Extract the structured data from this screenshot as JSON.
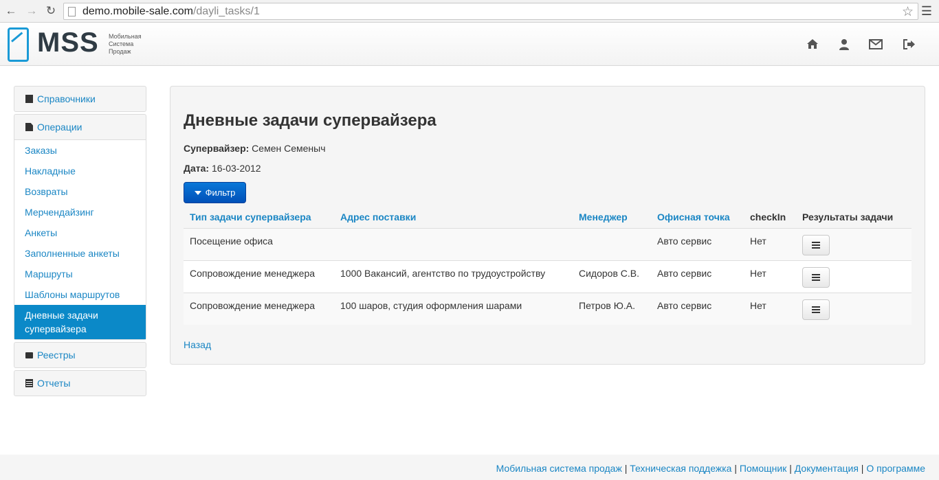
{
  "browser": {
    "url_host": "demo.mobile-sale.com",
    "url_path": "/dayli_tasks/1"
  },
  "header": {
    "logo_text": "MSS",
    "logo_sub_1": "Мобильная",
    "logo_sub_2": "Система",
    "logo_sub_3": "Продаж"
  },
  "sidebar": {
    "ref_label": "Справочники",
    "ops_label": "Операции",
    "ops_items": [
      {
        "label": "Заказы"
      },
      {
        "label": "Накладные"
      },
      {
        "label": "Возвраты"
      },
      {
        "label": "Мерчендайзинг"
      },
      {
        "label": "Анкеты"
      },
      {
        "label": "Заполненные анкеты"
      },
      {
        "label": "Маршруты"
      },
      {
        "label": "Шаблоны маршрутов"
      },
      {
        "label": "Дневные задачи супервайзера"
      }
    ],
    "registers_label": "Реестры",
    "reports_label": "Отчеты"
  },
  "main": {
    "title": "Дневные задачи супервайзера",
    "supervisor_label": "Супервайзер:",
    "supervisor_value": "Семен Семеныч",
    "date_label": "Дата:",
    "date_value": "16-03-2012",
    "filter_label": "Фильтр",
    "columns": {
      "type": "Тип задачи супервайзера",
      "address": "Адрес поставки",
      "manager": "Менеджер",
      "office": "Офисная точка",
      "checkin": "checkIn",
      "results": "Результаты задачи"
    },
    "rows": [
      {
        "type": "Посещение офиса",
        "address": "",
        "manager": "",
        "office": "Авто сервис",
        "checkin": "Нет"
      },
      {
        "type": "Сопровождение менеджера",
        "address": "1000 Вакансий, агентство по трудоустройству",
        "manager": "Сидоров С.В.",
        "office": "Авто сервис",
        "checkin": "Нет"
      },
      {
        "type": "Сопровождение менеджера",
        "address": "100 шаров, студия оформления шарами",
        "manager": "Петров Ю.А.",
        "office": "Авто сервис",
        "checkin": "Нет"
      }
    ],
    "back_label": "Назад"
  },
  "footer": {
    "links": [
      "Мобильная система продаж",
      "Техническая поддежка",
      "Помощник",
      "Документация",
      "О программе"
    ],
    "separator": " | "
  },
  "colors": {
    "accent": "#1a86c4",
    "active_bg": "#0b89c8",
    "button_primary": "#0a6fd0"
  },
  "icons": {
    "home": "home-icon",
    "user": "user-icon",
    "mail": "envelope-icon",
    "logout": "logout-icon"
  }
}
